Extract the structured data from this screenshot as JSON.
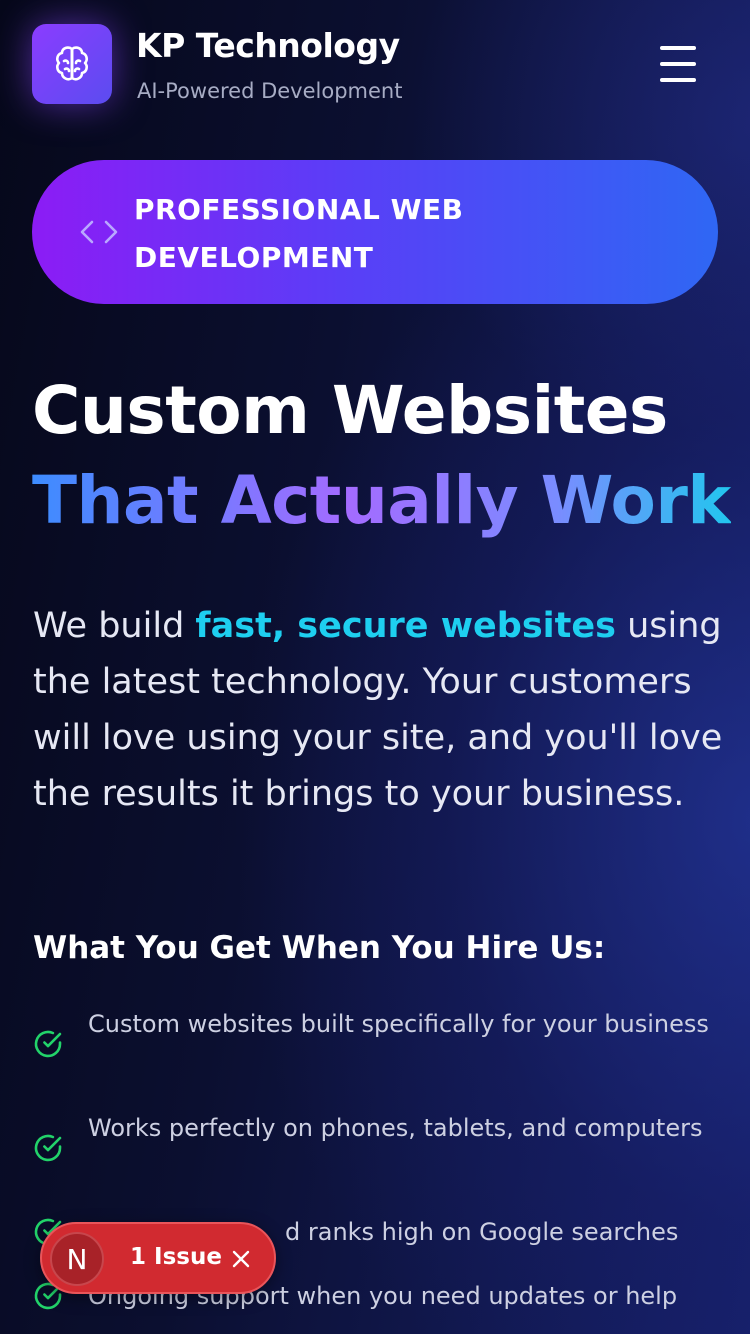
{
  "header": {
    "brand_title": "KP Technology",
    "brand_subtitle": "AI-Powered Development",
    "logo_icon": "brain-icon",
    "menu_icon": "hamburger-menu-icon"
  },
  "badge": {
    "icon": "code-brackets-icon",
    "label": "PROFESSIONAL WEB DEVELOPMENT"
  },
  "hero": {
    "headline_line1": "Custom Websites",
    "headline_line2": "That Actually Work",
    "lead_prefix": "We build ",
    "lead_highlight": "fast, secure websites",
    "lead_suffix": " using the latest technology. Your customers will love using your site, and you'll love the results it brings to your business."
  },
  "benefits": {
    "title": "What You Get When You Hire Us:",
    "check_icon": "check-circle-icon",
    "items": [
      "Custom websites built specifically for your business",
      "Works perfectly on phones, tablets, and computers",
      "d ranks high on Google searches",
      "Ongoing support when you need updates or help"
    ]
  },
  "issue_indicator": {
    "avatar_letter": "N",
    "label": "1 Issue",
    "close_icon": "close-icon"
  },
  "colors": {
    "accent_cyan": "#1ecff0",
    "check_green": "#22d36a",
    "badge_start": "#8c1cf5",
    "badge_end": "#2f67f4",
    "issue_red": "#d12a30"
  }
}
